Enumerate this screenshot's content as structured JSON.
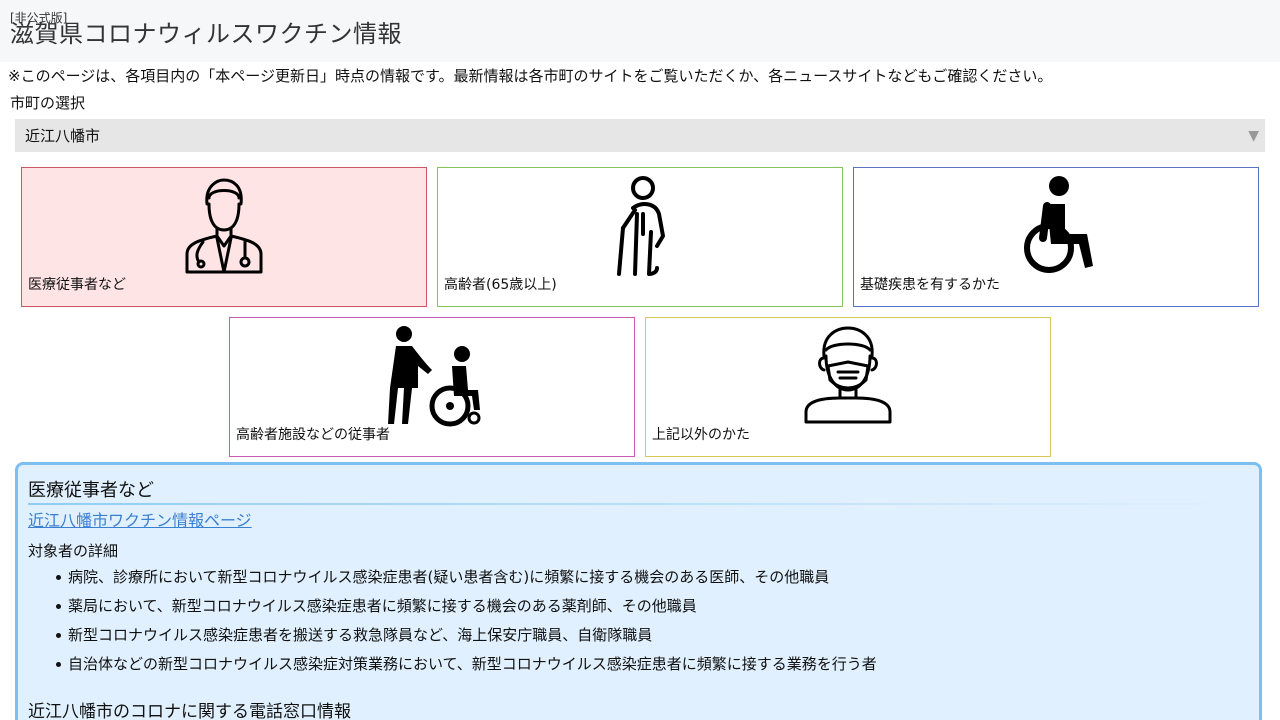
{
  "header": {
    "unofficial": "[非公式版]",
    "title": "滋賀県コロナウィルスワクチン情報"
  },
  "notice": "※このページは、各項目内の「本ページ更新日」時点の情報です。最新情報は各市町のサイトをご覧いただくか、各ニュースサイトなどもご確認ください。",
  "city_select": {
    "label": "市町の選択",
    "value": "近江八幡市"
  },
  "categories": [
    {
      "label": "医療従事者など",
      "icon": "doctor-icon",
      "color": "#c95a62"
    },
    {
      "label": "高齢者(65歳以上)",
      "icon": "elderly-person-icon",
      "color": "#86c45a"
    },
    {
      "label": "基礎疾患を有するかた",
      "icon": "wheelchair-icon",
      "color": "#5a72c4"
    },
    {
      "label": "高齢者施設などの従事者",
      "icon": "caregiver-icon",
      "color": "#c95ab4"
    },
    {
      "label": "上記以外のかた",
      "icon": "masked-person-icon",
      "color": "#d6c85a"
    }
  ],
  "detail": {
    "heading": "医療従事者など",
    "link_text": "近江八幡市ワクチン情報ページ",
    "subheading": "対象者の詳細",
    "items": [
      "病院、診療所において新型コロナウイルス感染症患者(疑い患者含む)に頻繁に接する機会のある医師、その他職員",
      "薬局において、新型コロナウイルス感染症患者に頻繁に接する機会のある薬剤師、その他職員",
      "新型コロナウイルス感染症患者を搬送する救急隊員など、海上保安庁職員、自衛隊職員",
      "自治体などの新型コロナウイルス感染症対策業務において、新型コロナウイルス感染症患者に頻繁に接する業務を行う者"
    ],
    "phone_heading": "近江八幡市のコロナに関する電話窓口情報"
  }
}
